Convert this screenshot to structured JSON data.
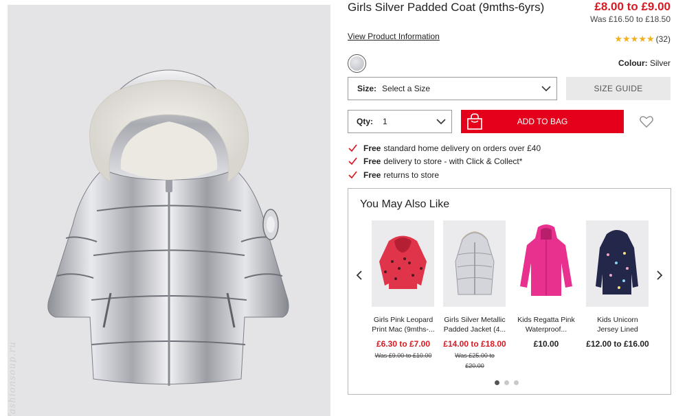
{
  "product": {
    "title": "Girls Silver Padded Coat (9mths-6yrs)",
    "price_now": "£8.00 to £9.00",
    "price_was": "Was £16.50 to £18.50",
    "view_info": "View Product Information",
    "rating_stars": 5,
    "rating_count": "(32)",
    "colour_label": "Colour:",
    "colour_value": "Silver"
  },
  "options": {
    "size_label": "Size:",
    "size_value": "Select a Size",
    "size_guide": "SIZE GUIDE",
    "qty_label": "Qty:",
    "qty_value": "1",
    "add_to_bag": "ADD TO BAG"
  },
  "perks": [
    {
      "bold": "Free",
      "text": "standard home delivery on orders over £40"
    },
    {
      "bold": "Free",
      "text": "delivery to store - with Click & Collect*"
    },
    {
      "bold": "Free",
      "text": "returns to store"
    }
  ],
  "recommendations": {
    "title": "You May Also Like",
    "items": [
      {
        "name": "Girls Pink Leopard Print Mac (9mths-...",
        "price": "£6.30 to £7.00",
        "was": "Was £9.00 to £10.00",
        "price_color": "red"
      },
      {
        "name": "Girls Silver Metallic Padded Jacket (4...",
        "price": "£14.00 to £18.00",
        "was": "Was £25.00 to £20.00",
        "price_color": "red"
      },
      {
        "name": "Kids Regatta Pink Waterproof...",
        "price": "£10.00",
        "was": "",
        "price_color": "black"
      },
      {
        "name": "Kids Unicorn Jersey Lined Hooded Ma...",
        "price": "£12.00 to £16.00",
        "was": "",
        "price_color": "black"
      }
    ],
    "page_count": 3,
    "active_page": 1
  },
  "watermark": "fashionsoup.ru",
  "colors": {
    "accent_red": "#e4001b",
    "price_red": "#d71921",
    "star": "#f2b01e"
  }
}
